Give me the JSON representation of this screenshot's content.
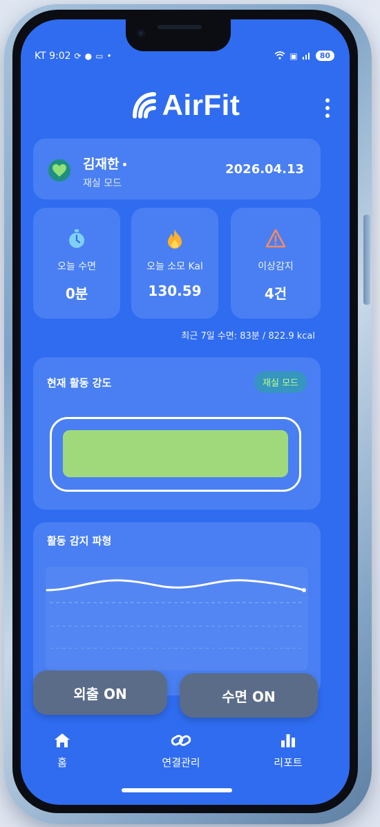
{
  "status_bar": {
    "carrier_time": "KT 9:02",
    "left_icons": [
      "sync-icon",
      "talk-icon",
      "screen-icon"
    ],
    "right_icons": [
      "wifi-icon",
      "lte-icon",
      "signal-icon"
    ],
    "battery": "80"
  },
  "header": {
    "app_name": "AirFit",
    "menu_icon": "more-vertical-icon"
  },
  "user": {
    "name": "김재한",
    "mode": "재실 모드",
    "date": "2026.04.13",
    "status_icon": "heart-icon"
  },
  "stats": [
    {
      "label": "오늘 수면",
      "value": "0분",
      "icon": "stopwatch-icon",
      "color": "#7fd0f5"
    },
    {
      "label": "오늘 소모 Kal",
      "value": "130.59",
      "icon": "flame-icon",
      "color": "#ffb02e"
    },
    {
      "label": "이상감지",
      "value": "4건",
      "icon": "warning-icon",
      "color": "#ff8a5c"
    }
  ],
  "summary": "최근 7일 수면: 83분 / 822.9 kcal",
  "activity": {
    "title": "현재 활동 강도",
    "mode_badge": "재실 모드",
    "level": 1.0,
    "fill_color": "#9fd97c"
  },
  "waveform": {
    "title": "활동 감지 파형"
  },
  "actions": {
    "out_label": "외출 ON",
    "sleep_label": "수면 ON"
  },
  "tabs": [
    {
      "label": "홈",
      "icon": "home-icon"
    },
    {
      "label": "연결관리",
      "icon": "link-icon"
    },
    {
      "label": "리포트",
      "icon": "bar-chart-icon"
    }
  ],
  "colors": {
    "screen_bg": "#2f6cf0",
    "button_bg": "#5b6c88",
    "accent_green": "#9fd97c"
  }
}
